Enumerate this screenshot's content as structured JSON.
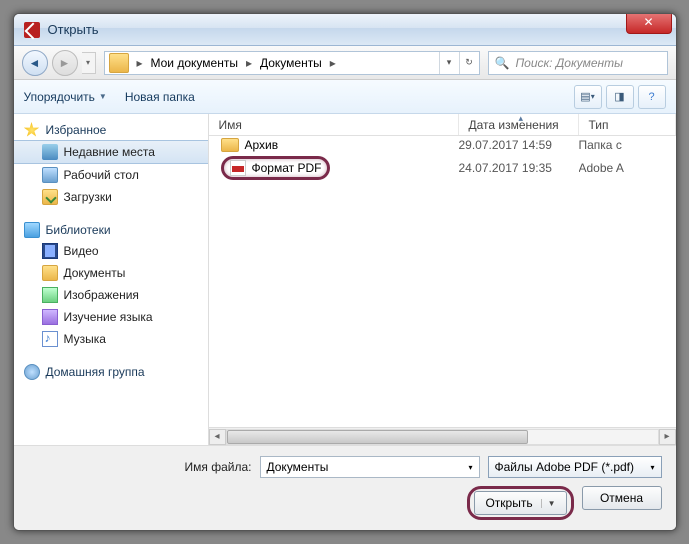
{
  "title": "Открыть",
  "breadcrumb": {
    "seg1": "Мои документы",
    "seg2": "Документы"
  },
  "search_placeholder": "Поиск: Документы",
  "toolbar": {
    "organize": "Упорядочить",
    "newfolder": "Новая папка"
  },
  "sidebar": {
    "favorites": "Избранное",
    "recent": "Недавние места",
    "desktop": "Рабочий стол",
    "downloads": "Загрузки",
    "libraries": "Библиотеки",
    "video": "Видео",
    "documents": "Документы",
    "images": "Изображения",
    "language": "Изучение языка",
    "music": "Музыка",
    "homegroup": "Домашняя группа"
  },
  "columns": {
    "name": "Имя",
    "date": "Дата изменения",
    "type": "Тип"
  },
  "files": {
    "r0": {
      "name": "Архив",
      "date": "29.07.2017 14:59",
      "type": "Папка с"
    },
    "r1": {
      "name": "Формат PDF",
      "date": "24.07.2017 19:35",
      "type": "Adobe A"
    }
  },
  "footer": {
    "fname_label": "Имя файла:",
    "fname_value": "Документы",
    "ftype": "Файлы Adobe PDF (*.pdf)",
    "open": "Открыть",
    "cancel": "Отмена"
  }
}
